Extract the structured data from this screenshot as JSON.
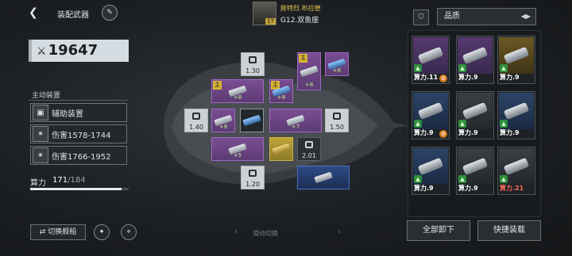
{
  "header": {
    "back_icon": "chevron-left-icon",
    "title": "装配武器",
    "edit_icon": "pen-icon",
    "pilot_level": "17",
    "pilot_name": "腓特烈.布拉德",
    "ship_name": "G12.双鱼座"
  },
  "left": {
    "power": "19647",
    "active_label": "主动装置",
    "skills": [
      {
        "label": "辅助装置",
        "icon": "device-icon"
      },
      {
        "label": "伤害1578-1744",
        "icon": "damage-icon"
      },
      {
        "label": "伤害1766-1952",
        "icon": "damage-icon"
      }
    ],
    "stat_label": "算力",
    "stat_value": "171",
    "stat_max": "/184",
    "stat_fraction": 0.929,
    "switch_ship": "切换舰船",
    "swipe_hint": "滑动切换"
  },
  "slots": {
    "main_badge": "主",
    "locked_top": "1.30",
    "locked_left": "1.40",
    "locked_right": "1.50",
    "locked_bottom": "1.20",
    "locked_dark": "2.01",
    "plus_values": [
      "+8",
      "+6",
      "+8",
      "+8",
      "+8",
      "+7",
      "+5"
    ]
  },
  "right": {
    "quality_label": "品质",
    "cards": [
      {
        "power": "算力.11",
        "quality": "purple",
        "gear": true,
        "red": false
      },
      {
        "power": "算力.9",
        "quality": "purple",
        "gear": false,
        "red": false
      },
      {
        "power": "算力.9",
        "quality": "gold",
        "gear": false,
        "red": false
      },
      {
        "power": "算力.9",
        "quality": "blue",
        "gear": true,
        "red": false
      },
      {
        "power": "算力.9",
        "quality": "grey",
        "gear": false,
        "red": false
      },
      {
        "power": "算力.9",
        "quality": "blue",
        "gear": false,
        "red": false
      },
      {
        "power": "算力.9",
        "quality": "blue",
        "gear": false,
        "red": false
      },
      {
        "power": "算力.9",
        "quality": "grey",
        "gear": false,
        "red": false
      },
      {
        "power": "算力.21",
        "quality": "grey",
        "gear": false,
        "red": true
      }
    ],
    "unload_all": "全部卸下",
    "quick_equip": "快捷装载"
  }
}
